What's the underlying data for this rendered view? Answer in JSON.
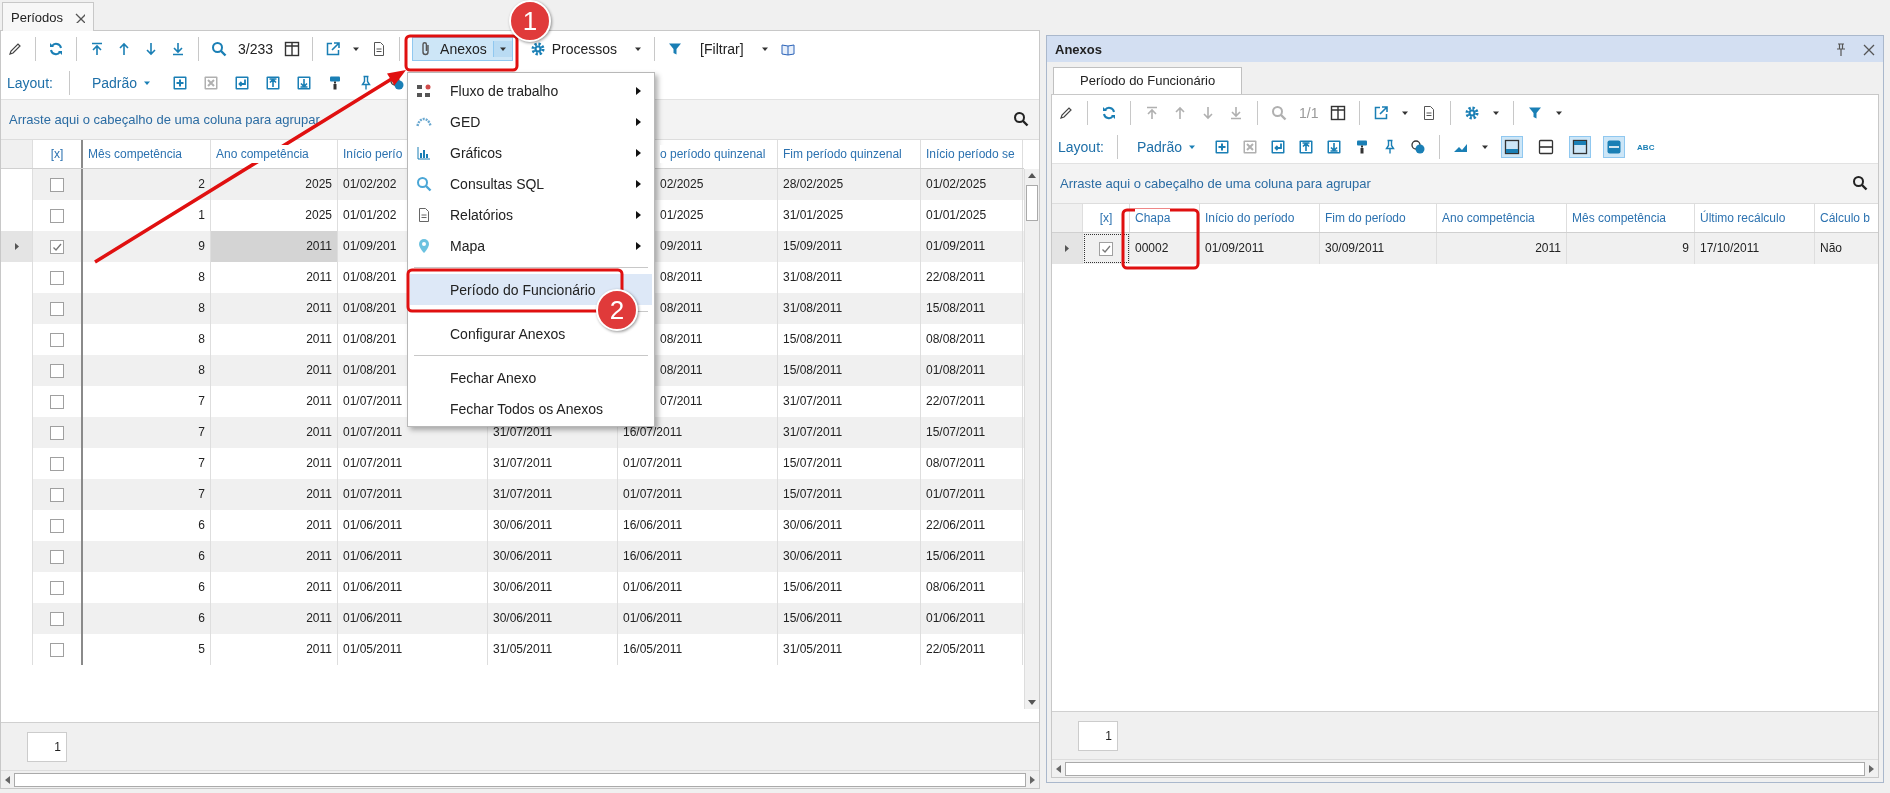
{
  "tabs": [
    {
      "label": "Períodos",
      "selected": true
    }
  ],
  "toolbar": {
    "record_counter": "3/233",
    "attachments_button": {
      "label": "Anexos",
      "pressed": true
    },
    "processes_button": {
      "label": "Processos"
    },
    "filter_button": {
      "label": "[Filtrar]"
    }
  },
  "layout_bar": {
    "label": "Layout:",
    "layout": "Padrão"
  },
  "group_panel": "Arraste aqui o cabeçalho de uma coluna para agrupar",
  "grid": {
    "check_header": "[x]",
    "columns": [
      "Mês competência",
      "Ano competência",
      "Início perío",
      null,
      "o período quinzenal",
      "Fim período quinzenal",
      "Início período se"
    ],
    "rows": [
      {
        "selected": false,
        "checked": false,
        "cells": [
          "2",
          "2025",
          "01/02/202",
          null,
          "02/2025",
          "28/02/2025",
          "01/02/2025"
        ]
      },
      {
        "selected": false,
        "checked": false,
        "cells": [
          "1",
          "2025",
          "01/01/202",
          null,
          "01/2025",
          "31/01/2025",
          "01/01/2025"
        ]
      },
      {
        "selected": true,
        "checked": true,
        "cells": [
          "9",
          "2011",
          "01/09/201",
          null,
          "09/2011",
          "15/09/2011",
          "01/09/2011"
        ]
      },
      {
        "selected": false,
        "checked": false,
        "cells": [
          "8",
          "2011",
          "01/08/201",
          null,
          "08/2011",
          "31/08/2011",
          "22/08/2011"
        ]
      },
      {
        "selected": false,
        "checked": false,
        "cells": [
          "8",
          "2011",
          "01/08/201",
          null,
          "08/2011",
          "31/08/2011",
          "15/08/2011"
        ]
      },
      {
        "selected": false,
        "checked": false,
        "cells": [
          "8",
          "2011",
          "01/08/201",
          null,
          "08/2011",
          "15/08/2011",
          "08/08/2011"
        ]
      },
      {
        "selected": false,
        "checked": false,
        "cells": [
          "8",
          "2011",
          "01/08/201",
          null,
          "08/2011",
          "15/08/2011",
          "01/08/2011"
        ]
      },
      {
        "selected": false,
        "checked": false,
        "cells": [
          "7",
          "2011",
          "01/07/2011",
          null,
          "07/2011",
          "31/07/2011",
          "22/07/2011"
        ]
      },
      {
        "selected": false,
        "checked": false,
        "cells": [
          "7",
          "2011",
          "01/07/2011",
          "31/07/2011",
          "16/07/2011",
          "31/07/2011",
          "15/07/2011"
        ]
      },
      {
        "selected": false,
        "checked": false,
        "cells": [
          "7",
          "2011",
          "01/07/2011",
          "31/07/2011",
          "01/07/2011",
          "15/07/2011",
          "08/07/2011"
        ]
      },
      {
        "selected": false,
        "checked": false,
        "cells": [
          "7",
          "2011",
          "01/07/2011",
          "31/07/2011",
          "01/07/2011",
          "15/07/2011",
          "01/07/2011"
        ]
      },
      {
        "selected": false,
        "checked": false,
        "cells": [
          "6",
          "2011",
          "01/06/2011",
          "30/06/2011",
          "16/06/2011",
          "30/06/2011",
          "22/06/2011"
        ]
      },
      {
        "selected": false,
        "checked": false,
        "cells": [
          "6",
          "2011",
          "01/06/2011",
          "30/06/2011",
          "16/06/2011",
          "30/06/2011",
          "15/06/2011"
        ]
      },
      {
        "selected": false,
        "checked": false,
        "cells": [
          "6",
          "2011",
          "01/06/2011",
          "30/06/2011",
          "01/06/2011",
          "15/06/2011",
          "08/06/2011"
        ]
      },
      {
        "selected": false,
        "checked": false,
        "cells": [
          "6",
          "2011",
          "01/06/2011",
          "30/06/2011",
          "01/06/2011",
          "15/06/2011",
          "01/06/2011"
        ]
      },
      {
        "selected": false,
        "checked": false,
        "cells": [
          "5",
          "2011",
          "01/05/2011",
          "31/05/2011",
          "16/05/2011",
          "31/05/2011",
          "22/05/2011"
        ]
      }
    ]
  },
  "pager": "1",
  "attachments_menu": {
    "items": [
      {
        "kind": "submenu",
        "label": "Fluxo de trabalho",
        "selected": false
      },
      {
        "kind": "submenu",
        "label": "GED",
        "selected": false
      },
      {
        "kind": "submenu",
        "label": "Gráficos",
        "selected": false
      },
      {
        "kind": "submenu",
        "label": "Consultas SQL",
        "selected": false
      },
      {
        "kind": "submenu",
        "label": "Relatórios",
        "selected": false
      },
      {
        "kind": "submenu",
        "label": "Mapa",
        "selected": false
      },
      {
        "kind": "separator"
      },
      {
        "kind": "item",
        "label": "Período do Funcionário",
        "selected": true
      },
      {
        "kind": "separator"
      },
      {
        "kind": "item",
        "label": "Configurar Anexos",
        "selected": false
      },
      {
        "kind": "separator"
      },
      {
        "kind": "item",
        "label": "Fechar Anexo",
        "selected": false
      },
      {
        "kind": "item",
        "label": "Fechar Todos os Anexos",
        "selected": false
      }
    ]
  },
  "attachments_panel": {
    "title": "Anexos",
    "tabs": [
      {
        "label": "Período do Funcionário",
        "selected": true
      }
    ],
    "toolbar": {
      "record_counter": "1/1"
    },
    "layout_bar": {
      "label": "Layout:",
      "layout": "Padrão",
      "view_toggles": [
        {
          "pressed": true
        },
        {
          "pressed": false
        },
        {
          "pressed": true
        },
        {
          "pressed": true
        }
      ],
      "spell_button": "ABC"
    },
    "group_panel": "Arraste aqui o cabeçalho de uma coluna para agrupar",
    "grid": {
      "check_header": "[x]",
      "columns": [
        "Chapa",
        "Início do período",
        "Fim do período",
        "Ano competência",
        "Mês competência",
        "Último recálculo",
        "Cálculo b"
      ],
      "rows": [
        {
          "selected": true,
          "checked": true,
          "cells": [
            "00002",
            "01/09/2011",
            "30/09/2011",
            "2011",
            "9",
            "17/10/2011",
            "Não"
          ]
        }
      ]
    },
    "pager": "1"
  },
  "annotations": [
    {
      "label": "1"
    },
    {
      "label": "2"
    }
  ]
}
